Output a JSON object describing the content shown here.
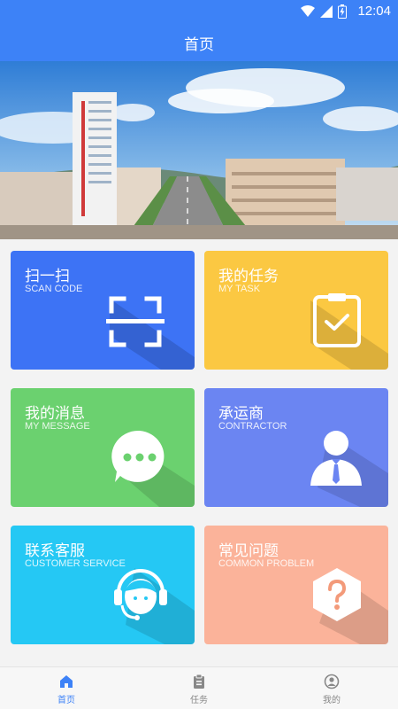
{
  "status": {
    "time": "12:04"
  },
  "header": {
    "title": "首页"
  },
  "banner": {
    "dots": 3,
    "active_dot": 0
  },
  "cards": [
    {
      "title": "扫一扫",
      "subtitle": "SCAN CODE"
    },
    {
      "title": "我的任务",
      "subtitle": "MY TASK"
    },
    {
      "title": "我的消息",
      "subtitle": "MY MESSAGE"
    },
    {
      "title": "承运商",
      "subtitle": "CONTRACTOR"
    },
    {
      "title": "联系客服",
      "subtitle": "CUSTOMER SERVICE"
    },
    {
      "title": "常见问题",
      "subtitle": "COMMON PROBLEM"
    }
  ],
  "nav": [
    {
      "label": "首页",
      "icon": "home-icon",
      "active": true
    },
    {
      "label": "任务",
      "icon": "clipboard-icon",
      "active": false
    },
    {
      "label": "我的",
      "icon": "user-circle-icon",
      "active": false
    }
  ],
  "colors": {
    "primary": "#3d82f7",
    "scan": "#3d73f5",
    "task": "#fbc842",
    "message": "#6bd16f",
    "contractor": "#6b85f2",
    "service": "#25c8f4",
    "problem": "#fbb39a"
  }
}
